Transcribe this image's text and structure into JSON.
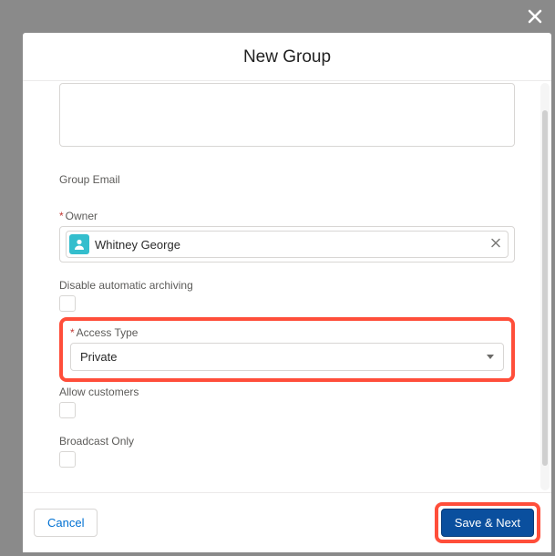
{
  "modal": {
    "title": "New Group",
    "close_icon": "close"
  },
  "fields": {
    "group_email_label": "Group Email",
    "owner_label": "Owner",
    "owner_value": "Whitney George",
    "disable_archive_label": "Disable automatic archiving",
    "access_type_label": "Access Type",
    "access_type_value": "Private",
    "allow_customers_label": "Allow customers",
    "broadcast_only_label": "Broadcast Only"
  },
  "footer": {
    "cancel": "Cancel",
    "save_next": "Save & Next"
  }
}
